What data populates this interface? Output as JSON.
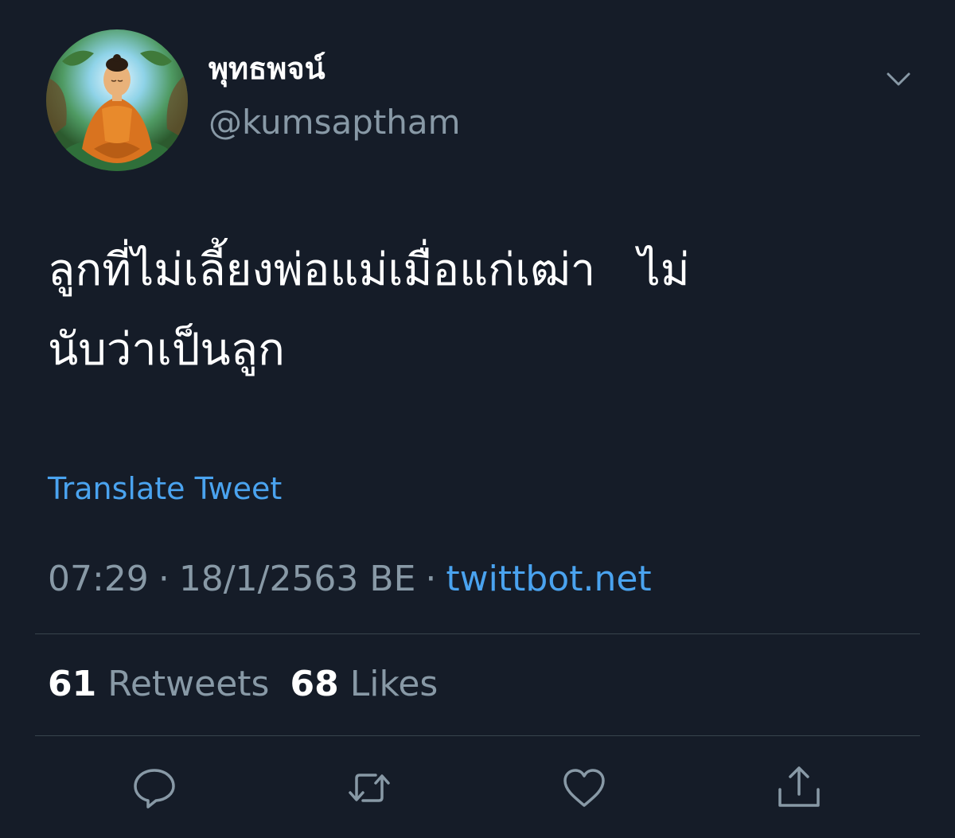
{
  "tweet": {
    "author": {
      "display_name": "พุทธพจน์",
      "handle": "@kumsaptham",
      "avatar_icon": "buddha-avatar"
    },
    "text": "ลูกที่ไม่เลี้ยงพ่อแม่เมื่อแก่เฒ่า   ไม่\nนับว่าเป็นลูก",
    "translate_label": "Translate Tweet",
    "time": "07:29",
    "date": "18/1/2563 BE",
    "separator": "·",
    "source": "twittbot.net",
    "stats": {
      "retweets_count": "61",
      "retweets_label": "Retweets",
      "likes_count": "68",
      "likes_label": "Likes"
    },
    "actions": [
      "reply-icon",
      "retweet-icon",
      "like-icon",
      "share-icon"
    ]
  },
  "colors": {
    "background": "#151c28",
    "text_primary": "#ffffff",
    "text_secondary": "#8899a6",
    "link": "#4aa3ef",
    "divider": "#38444d"
  }
}
